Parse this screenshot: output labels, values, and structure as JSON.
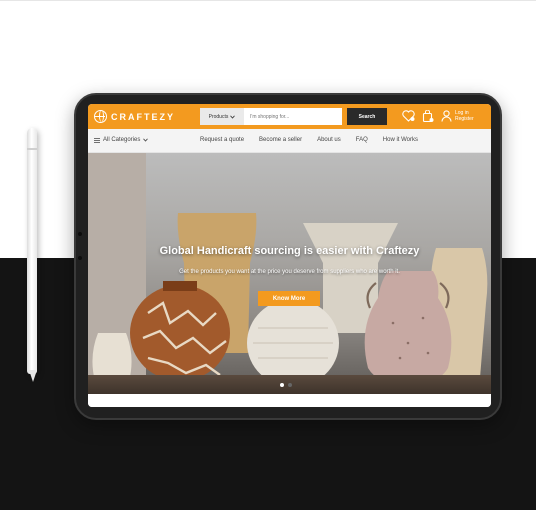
{
  "header": {
    "logo_text": "CRAFTEZY",
    "search_category": "Products",
    "search_placeholder": "I'm shopping for...",
    "search_button": "Search",
    "login_line1": "Log in",
    "login_line2": "Register"
  },
  "nav": {
    "all_categories": "All Categories",
    "links": [
      "Request a quote",
      "Become a seller",
      "About us",
      "FAQ",
      "How it Works"
    ]
  },
  "hero": {
    "title": "Global Handicraft sourcing is easier with Craftezy",
    "subtitle": "Get the products you want at the price you deserve from suppliers who are worth it.",
    "cta": "Know More",
    "slide_count": 2,
    "active_slide": 1
  },
  "colors": {
    "accent": "#f39a1f",
    "dark": "#2a2a2a",
    "nav_bg": "#f4f4f4",
    "page_bottom": "#141414"
  },
  "icons": [
    "globe-logo-icon",
    "chevron-down-icon",
    "wishlist-heart-icon",
    "cart-icon",
    "user-icon"
  ]
}
